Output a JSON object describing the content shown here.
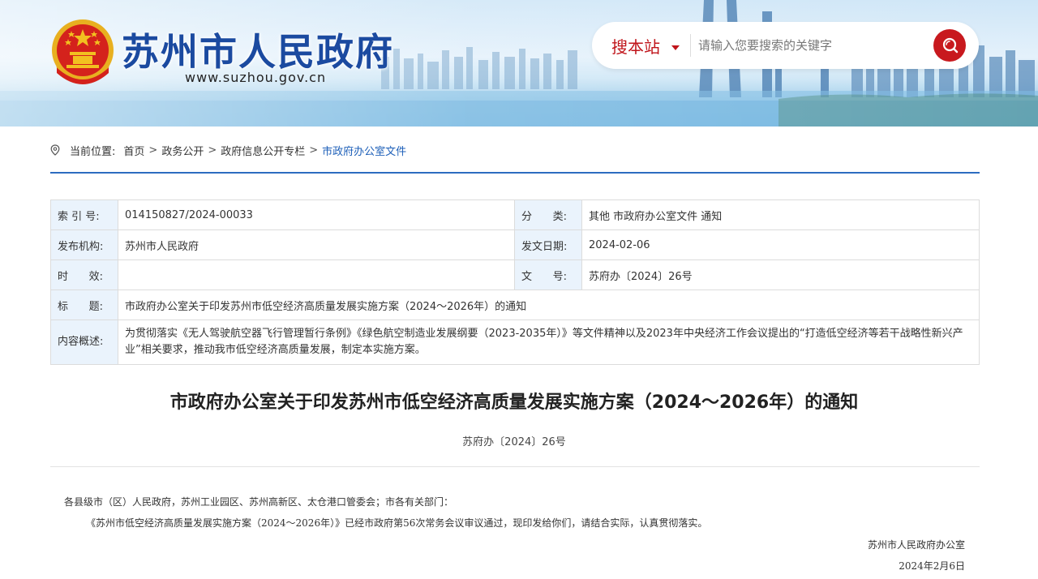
{
  "header": {
    "site_title": "苏州市人民政府",
    "site_url": "www.suzhou.gov.cn",
    "search": {
      "scope_label": "搜本站",
      "placeholder": "请输入您要搜索的关键字"
    },
    "colors": {
      "title_blue": "#1b4aa0",
      "accent_red": "#c8191e"
    }
  },
  "breadcrumb": {
    "prefix": "当前位置:",
    "items": [
      "首页",
      "政务公开",
      "政府信息公开专栏",
      "市政府办公室文件"
    ],
    "separator": ">"
  },
  "meta": {
    "index_no_label": "索 引 号:",
    "index_no": "014150827/2024-00033",
    "category_label_chars": [
      "分",
      "类:"
    ],
    "category": "其他 市政府办公室文件 通知",
    "publisher_label": "发布机构:",
    "publisher": "苏州市人民政府",
    "date_label": "发文日期:",
    "date": "2024-02-06",
    "validity_label_chars": [
      "时",
      "效:"
    ],
    "validity": "",
    "doc_no_label_chars": [
      "文",
      "号:"
    ],
    "doc_no": "苏府办〔2024〕26号",
    "title_label_chars": [
      "标",
      "题:"
    ],
    "title": "市政府办公室关于印发苏州市低空经济高质量发展实施方案（2024～2026年）的通知",
    "summary_label": "内容概述:",
    "summary": "为贯彻落实《无人驾驶航空器飞行管理暂行条例》《绿色航空制造业发展纲要（2023-2035年）》等文件精神以及2023年中央经济工作会议提出的“打造低空经济等若干战略性新兴产业”相关要求，推动我市低空经济高质量发展，制定本实施方案。"
  },
  "article": {
    "title": "市政府办公室关于印发苏州市低空经济高质量发展实施方案（2024～2026年）的通知",
    "doc_no": "苏府办〔2024〕26号",
    "addressee": "各县级市（区）人民政府，苏州工业园区、苏州高新区、太仓港口管委会；市各有关部门：",
    "body": "《苏州市低空经济高质量发展实施方案（2024～2026年）》已经市政府第56次常务会议审议通过，现印发给你们，请结合实际，认真贯彻落实。",
    "signature": "苏州市人民政府办公室",
    "signed_date": "2024年2月6日"
  }
}
